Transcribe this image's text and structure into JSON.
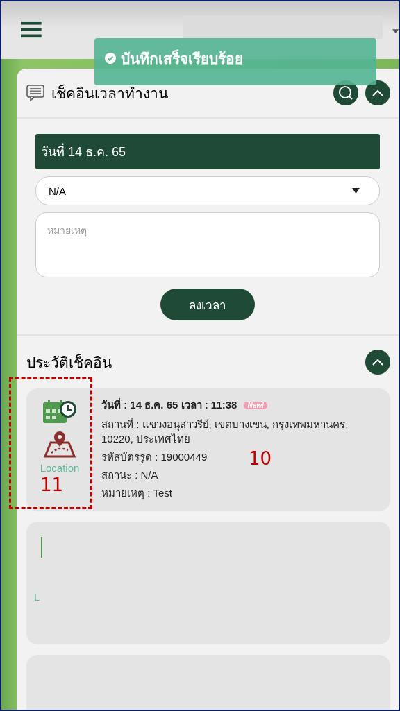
{
  "toast": {
    "message": "บันทึกเสร็จเรียบร้อย"
  },
  "checkin_panel": {
    "title": "เช็คอินเวลาทำงาน",
    "expanded": true,
    "date": "วันที่ 14 ธ.ค. 65",
    "status_select": {
      "value": "N/A"
    },
    "note": {
      "placeholder": "หมายเหตุ"
    },
    "submit": "ลงเวลา"
  },
  "history": {
    "title": "ประวัติเช็คอิน",
    "expanded": true,
    "entries": [
      {
        "kind": "full",
        "date_line": "วันที่ : 14 ธ.ค. 65 เวลา : 11:38",
        "badge": "New!",
        "icon_label": "Location",
        "lines": [
          "สถานที่ : แขวงอนุสาวรีย์, เขตบางเขน, กรุงเทพมหานคร, 10220, ประเทศไทย",
          "รหัสบัตรรูด : 19000449",
          "สถานะ : N/A",
          "หมายเหตุ : Test"
        ]
      },
      {
        "kind": "loading",
        "icon_label": "L"
      },
      {
        "kind": "blank"
      }
    ]
  },
  "annotations": {
    "box_label": "11",
    "card_label": "10"
  }
}
